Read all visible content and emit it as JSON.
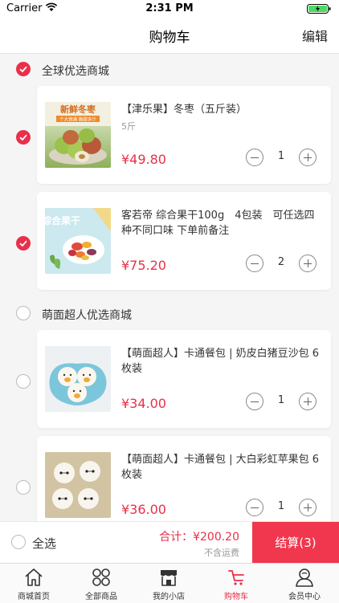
{
  "status_bar": {
    "carrier": "Carrier",
    "time": "2:31 PM"
  },
  "nav": {
    "title": "购物车",
    "edit_label": "编辑"
  },
  "shops": [
    {
      "name": "全球优选商城",
      "checked": true,
      "items": [
        {
          "title": "【津乐果】冬枣（五斤装）",
          "spec": "5斤",
          "price": "¥49.80",
          "qty": "1",
          "checked": true,
          "image_icon": "winter-jujube-photo",
          "image_banner": "新鲜冬枣",
          "image_sub": "个大饱满 脆甜多汁"
        },
        {
          "title": "客若帝 综合果干100g　4包装　可任选四种不同口味 下单前备注",
          "spec": "",
          "price": "¥75.20",
          "qty": "2",
          "checked": true,
          "image_icon": "dried-fruit-photo",
          "image_banner": "综合果干"
        }
      ]
    },
    {
      "name": "萌面超人优选商城",
      "checked": false,
      "items": [
        {
          "title": "【萌面超人】卡通餐包 | 奶皮白猪豆沙包 6枚装",
          "spec": "",
          "price": "¥34.00",
          "qty": "1",
          "checked": false,
          "image_icon": "piggy-bun-photo"
        },
        {
          "title": "【萌面超人】卡通餐包 | 大白彩虹苹果包 6枚装",
          "spec": "",
          "price": "¥36.00",
          "qty": "1",
          "checked": false,
          "image_icon": "baymax-bun-photo"
        }
      ]
    }
  ],
  "footer": {
    "select_all": "全选",
    "total_label": "合计：",
    "total": "¥200.20",
    "shipping_note": "不含运费",
    "checkout_label": "结算(3)"
  },
  "tabs": [
    {
      "label": "商城首页",
      "icon": "home-icon",
      "active": false
    },
    {
      "label": "全部商品",
      "icon": "grid-icon",
      "active": false
    },
    {
      "label": "我的小店",
      "icon": "store-icon",
      "active": false
    },
    {
      "label": "购物车",
      "icon": "cart-icon",
      "active": true
    },
    {
      "label": "会员中心",
      "icon": "user-icon",
      "active": false
    }
  ],
  "colors": {
    "accent": "#e8304a",
    "checkout_bg": "#f0374d",
    "page_bg": "#f5f5f5"
  }
}
